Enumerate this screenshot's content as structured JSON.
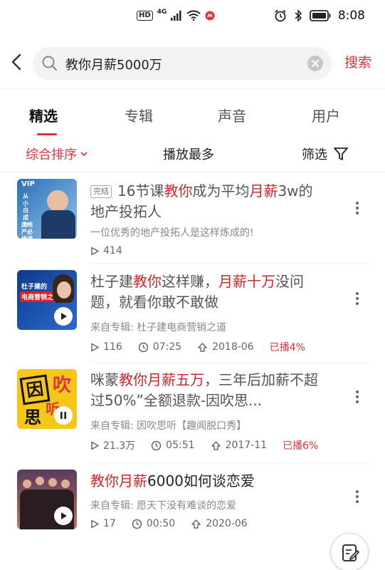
{
  "colors": {
    "accent": "#e3323b",
    "highlight": "#d1262e"
  },
  "status_bar": {
    "hd": "HD",
    "network": "4G",
    "time": "8:08"
  },
  "search": {
    "query": "教你月薪5000万",
    "button": "搜索"
  },
  "tabs": [
    {
      "label": "精选",
      "active": true
    },
    {
      "label": "专辑",
      "active": false
    },
    {
      "label": "声音",
      "active": false
    },
    {
      "label": "用户",
      "active": false
    }
  ],
  "filters": {
    "sort": "综合排序",
    "most_played": "播放最多",
    "filter": "筛选"
  },
  "items": [
    {
      "tag": "完结",
      "title_parts": [
        "16节课",
        "教你",
        "成为平均",
        "月薪",
        "3w的地产投拓人"
      ],
      "subtitle": "一位优秀的地产投拓人是这样炼成的!",
      "plays": "414",
      "thumb_text": {
        "vip": "VIP",
        "side": "从小白成为",
        "bottom": "房地产必修课"
      }
    },
    {
      "title_parts": [
        "杜子建",
        "教你",
        "这样赚，",
        "月薪",
        "十万",
        "没问题，就看你敢不敢做"
      ],
      "subtitle": "来自专辑: 杜子建电商营销之道",
      "plays": "116",
      "duration": "07:25",
      "date": "2018-06",
      "progress": "已播4%",
      "thumb_text": {
        "name": "杜子建的",
        "course": "电商营销之道"
      }
    },
    {
      "title_parts": [
        "咪蒙",
        "教你月薪",
        "五万",
        "，三年后加薪不超过50%”全额退款-因吹思..."
      ],
      "subtitle": "来自专辑: 因吹思听【趣闻脱口秀】",
      "plays": "21.3万",
      "duration": "05:51",
      "date": "2017-11",
      "progress": "已播6%",
      "thumb_text": {
        "a": "因",
        "b": "思",
        "c": "吹",
        "d": "听"
      }
    },
    {
      "title_parts": [
        "教你月薪",
        "6000如何谈恋爱"
      ],
      "subtitle": "来自专辑: 愿天下没有难谈的恋爱",
      "plays": "17",
      "duration": "00:50",
      "date": "2020-06"
    }
  ]
}
